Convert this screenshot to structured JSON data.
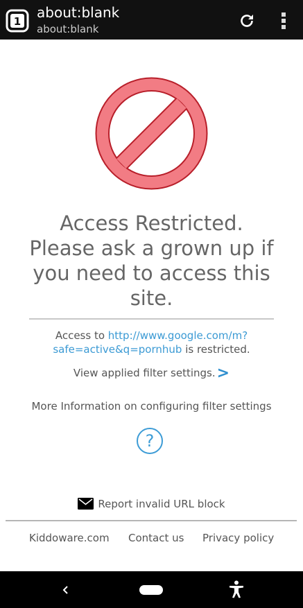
{
  "browser": {
    "tab_count": "1",
    "title": "about:blank",
    "url": "about:blank",
    "reload_icon": "reload-icon",
    "menu_icon": "overflow-menu-icon"
  },
  "block": {
    "icon": "prohibited-icon",
    "headline_lines": [
      "Access Restricted.",
      "Please ask a grown up if",
      "you need to access this",
      "site."
    ],
    "access_prefix": "Access to ",
    "blocked_url": "http://www.google.com/m?safe=active&q=pornhub",
    "access_suffix": " is restricted.",
    "view_filter_label": "View applied filter settings.",
    "view_filter_chevron": ">",
    "more_info_label": "More Information on configuring filter settings",
    "help_icon_text": "?",
    "report_label": "Report invalid URL block"
  },
  "footer": {
    "links": [
      "Kiddoware.com",
      "Contact us",
      "Privacy policy"
    ]
  },
  "colors": {
    "link": "#3b9ad4",
    "stop_fill": "#f27c84",
    "stop_stroke": "#c2222d",
    "text": "#555555"
  }
}
